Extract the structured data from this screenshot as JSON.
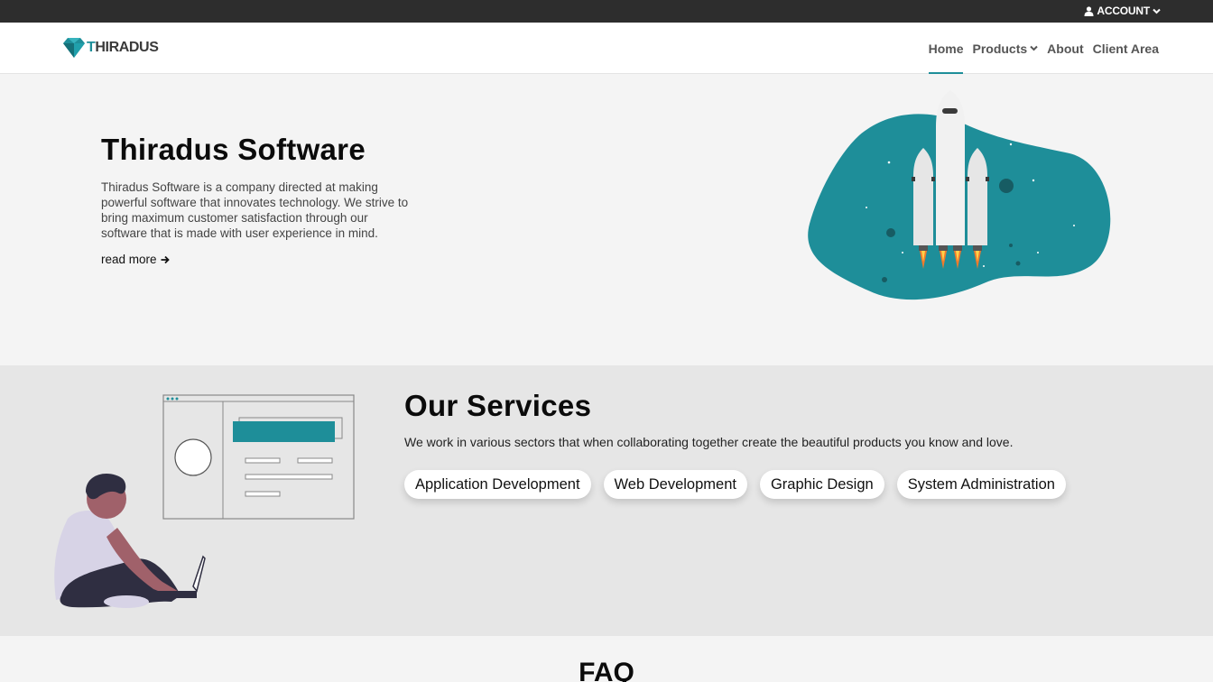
{
  "topbar": {
    "account_label": "ACCOUNT"
  },
  "brand": {
    "logo_first": "T",
    "logo_rest": "HIRADUS"
  },
  "nav": {
    "home": "Home",
    "products": "Products",
    "about": "About",
    "client_area": "Client Area"
  },
  "hero": {
    "title": "Thiradus Software",
    "text": "Thiradus Software is a company directed at making powerful software that innovates technology. We strive to bring maximum customer satisfaction through our software that is made with user experience in mind.",
    "read_more": "read more"
  },
  "services": {
    "title": "Our Services",
    "text": "We work in various sectors that when collaborating together create the beautiful products you know and love.",
    "items": [
      "Application Development",
      "Web Development",
      "Graphic Design",
      "System Administration"
    ]
  },
  "faq": {
    "title": "FAQ"
  },
  "colors": {
    "accent": "#1e8e99",
    "topbar": "#2d2d2d"
  }
}
